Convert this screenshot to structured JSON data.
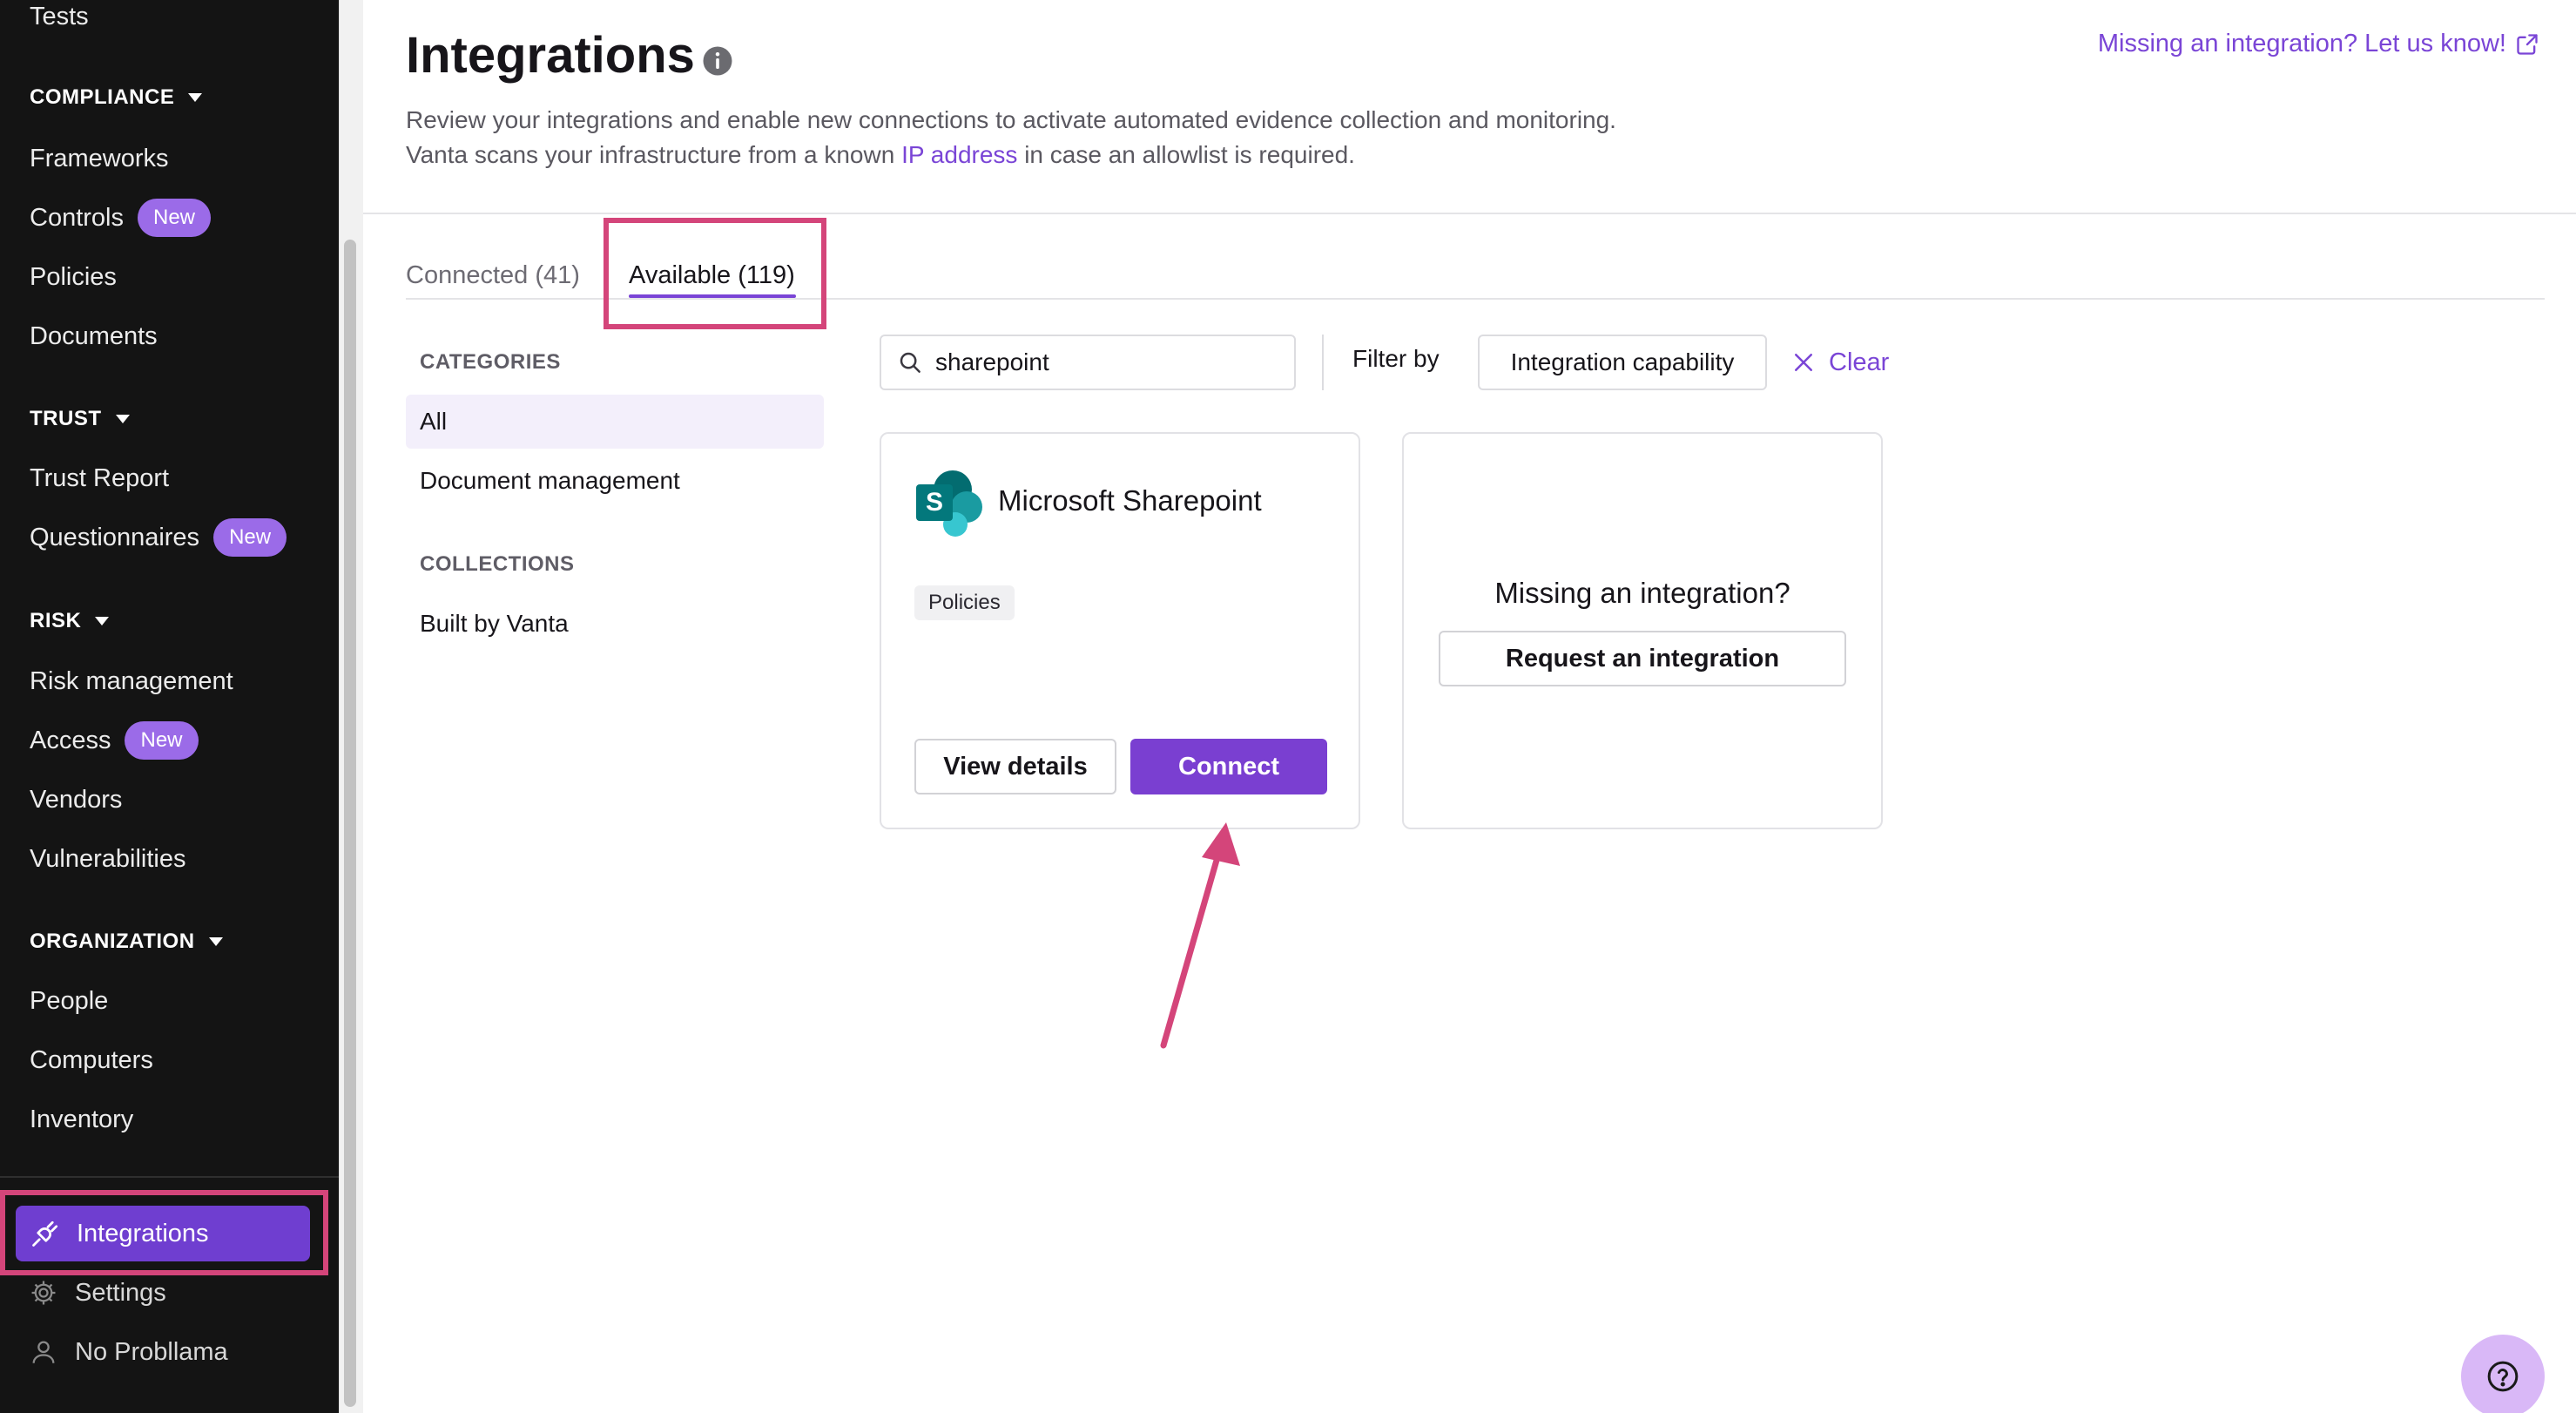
{
  "sidebar": {
    "top_item": "Tests",
    "sections": [
      {
        "title": "COMPLIANCE",
        "items": [
          {
            "label": "Frameworks",
            "badge": ""
          },
          {
            "label": "Controls",
            "badge": "New"
          },
          {
            "label": "Policies",
            "badge": ""
          },
          {
            "label": "Documents",
            "badge": ""
          }
        ]
      },
      {
        "title": "TRUST",
        "items": [
          {
            "label": "Trust Report",
            "badge": ""
          },
          {
            "label": "Questionnaires",
            "badge": "New"
          }
        ]
      },
      {
        "title": "RISK",
        "items": [
          {
            "label": "Risk management",
            "badge": ""
          },
          {
            "label": "Access",
            "badge": "New"
          },
          {
            "label": "Vendors",
            "badge": ""
          },
          {
            "label": "Vulnerabilities",
            "badge": ""
          }
        ]
      },
      {
        "title": "ORGANIZATION",
        "items": [
          {
            "label": "People",
            "badge": ""
          },
          {
            "label": "Computers",
            "badge": ""
          },
          {
            "label": "Inventory",
            "badge": ""
          }
        ]
      }
    ],
    "active_item": "Integrations",
    "settings": "Settings",
    "user": "No Probllama"
  },
  "header": {
    "title": "Integrations",
    "subtitle_before": "Review your integrations and enable new connections to activate automated evidence collection and monitoring. Vanta scans your infrastructure from a known ",
    "subtitle_link": "IP address",
    "subtitle_after": " in case an allowlist is required.",
    "missing_link": "Missing an integration? Let us know!"
  },
  "tabs": {
    "connected": "Connected (41)",
    "available": "Available (119)"
  },
  "categories": {
    "heading": "CATEGORIES",
    "items": [
      "All",
      "Document management"
    ],
    "collections_heading": "COLLECTIONS",
    "collections": [
      "Built by Vanta"
    ]
  },
  "search": {
    "value": "sharepoint",
    "placeholder": ""
  },
  "filter": {
    "label": "Filter by",
    "capability": "Integration capability",
    "clear": "Clear"
  },
  "cards": {
    "sharepoint": {
      "title": "Microsoft Sharepoint",
      "tag": "Policies",
      "view_details": "View details",
      "connect": "Connect",
      "logo_letter": "S"
    },
    "missing": {
      "title": "Missing an integration?",
      "button": "Request an integration"
    }
  },
  "colors": {
    "accent": "#7a45d6",
    "primary_button": "#7a3fd1",
    "annotation": "#d4457a",
    "sidebar_bg": "#141414"
  },
  "icons": [
    "info-icon",
    "external-link-icon",
    "search-icon",
    "close-icon",
    "plug-icon",
    "gear-icon",
    "user-icon",
    "help-icon",
    "sharepoint-logo"
  ]
}
